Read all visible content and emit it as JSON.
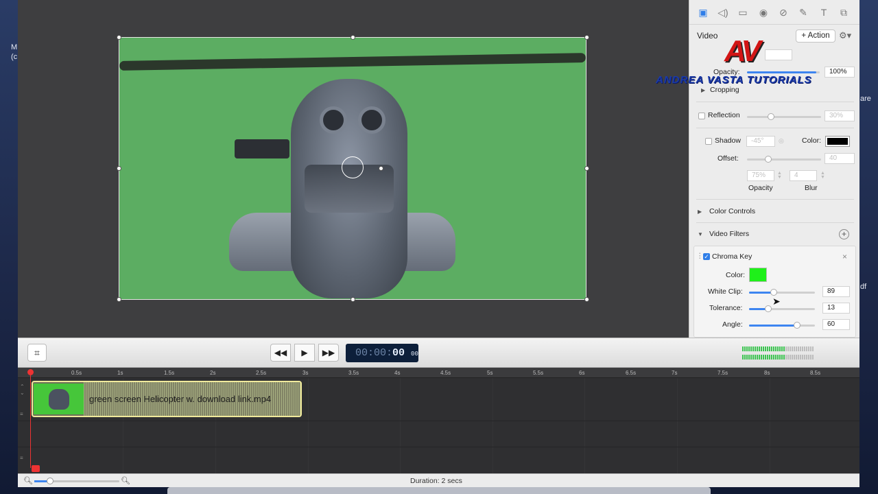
{
  "desktop": {
    "left_text": "M\n(c",
    "right_text": "are",
    "right_text2": "df"
  },
  "watermark": {
    "logo": "AV",
    "text": "ANDREA VASTA TUTORIALS"
  },
  "inspector": {
    "tabs": [
      "video-tab",
      "audio-tab",
      "display-tab",
      "cursor-tab",
      "effects-tab",
      "annotation-tab",
      "text-tab",
      "transform-tab"
    ],
    "title": "Video",
    "action_label": "+ Action",
    "opacity_label": "Opacity:",
    "opacity_value": "100%",
    "opacity_level": 0.95,
    "cropping_label": "Cropping",
    "reflection_label": "Reflection",
    "reflection_value": "30%",
    "shadow_label": "Shadow",
    "shadow_angle": "-45°",
    "shadow_color_label": "Color:",
    "offset_label": "Offset:",
    "offset_value": "40",
    "shadow_opacity_value": "75%",
    "blur_value": "4",
    "shadow_opacity_label": "Opacity",
    "blur_label": "Blur",
    "color_controls_label": "Color Controls",
    "video_filters_label": "Video Filters",
    "filter": {
      "name": "Chroma Key",
      "checked": true,
      "color_label": "Color:",
      "key_color": "#1ff01a",
      "white_clip_label": "White Clip:",
      "white_clip_value": "89",
      "white_clip_level": 0.38,
      "tolerance_label": "Tolerance:",
      "tolerance_value": "13",
      "tolerance_level": 0.29,
      "angle_label": "Angle:",
      "angle_value": "60",
      "angle_level": 0.73
    }
  },
  "transport": {
    "rewind_icon": "rewind-icon",
    "play_icon": "play-icon",
    "ffwd_icon": "fast-forward-icon",
    "timecode_dim": "00:00:",
    "timecode_bright": "00",
    "timecode_frames": "00",
    "meter_levels": [
      0.6,
      0.6
    ]
  },
  "timeline": {
    "ticks": [
      "0.5s",
      "1s",
      "1.5s",
      "2s",
      "2.5s",
      "3s",
      "3.5s",
      "4s",
      "4.5s",
      "5s",
      "5.5s",
      "6s",
      "6.5s",
      "7s",
      "7.5s",
      "8s",
      "8.5s"
    ],
    "clip_name": "green screen Helicopter w. download link.mp4"
  },
  "status": {
    "duration": "Duration: 2 secs"
  }
}
